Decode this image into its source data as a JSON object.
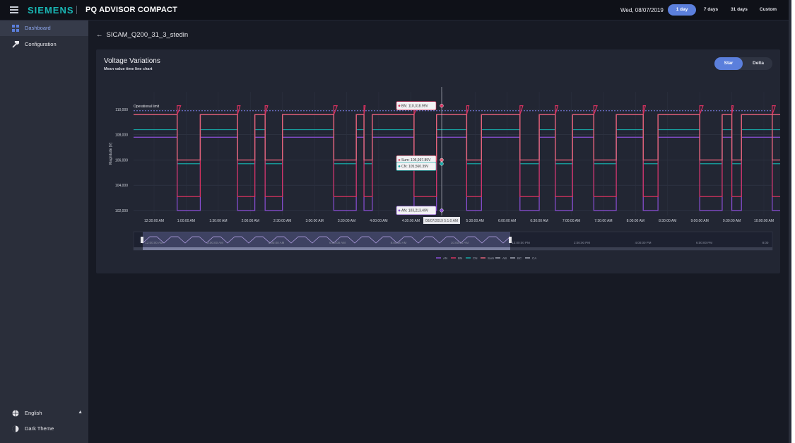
{
  "header": {
    "brand": "SIEMENS",
    "app_title": "PQ ADVISOR COMPACT",
    "date": "Wed, 08/07/2019",
    "ranges": [
      "1 day",
      "7 days",
      "31 days",
      "Custom"
    ],
    "active_range": "1 day"
  },
  "sidebar": {
    "items": [
      {
        "label": "Dashboard",
        "icon": "dashboard-icon",
        "active": true
      },
      {
        "label": "Configuration",
        "icon": "wrench-icon",
        "active": false
      }
    ],
    "footer": [
      {
        "label": "English",
        "icon": "globe-icon"
      },
      {
        "label": "Dark Theme",
        "icon": "contrast-icon"
      }
    ]
  },
  "main": {
    "back_label": "SICAM_Q200_31_3_stedin",
    "card": {
      "title": "Voltage Variations",
      "subtitle": "Mean value time line chart",
      "toggle": [
        "Star",
        "Delta"
      ],
      "toggle_active": "Star"
    }
  },
  "colors": {
    "AN": "#8b4fd6",
    "BN": "#d8325f",
    "CN": "#16a8a6",
    "Sum": "#e2627a",
    "limit": "#7c7ee8",
    "accent": "#5b7fdc"
  },
  "chart_data": {
    "type": "line",
    "title": "Voltage Variations",
    "subtitle": "Mean value time line chart",
    "ylabel": "Magnitude [V]",
    "y_ticks": [
      "110,000",
      "108,000",
      "106,000",
      "104,000",
      "102,000"
    ],
    "x_ticks": [
      "12:30:00 AM",
      "1:00:00 AM",
      "1:30:00 AM",
      "2:00:00 AM",
      "2:30:00 AM",
      "3:00:00 AM",
      "3:30:00 AM",
      "4:00:00 AM",
      "4:30:00 AM",
      "5:00:00 AM",
      "5:30:00 AM",
      "6:00:00 AM",
      "6:30:00 AM",
      "7:00:00 AM",
      "7:30:00 AM",
      "8:00:00 AM",
      "8:30:00 AM",
      "9:00:00 AM",
      "9:30:00 AM",
      "10:00:00 AM"
    ],
    "navigator_ticks": [
      "12:00:00 AM",
      "2:00:00 AM",
      "4:00:00 AM",
      "6:00:00 AM",
      "8:00:00 AM",
      "10:00:00 AM",
      "12:00:00 PM",
      "2:00:00 PM",
      "4:00:00 PM",
      "6:00:00 PM",
      "8:00"
    ],
    "operational_limit": {
      "label": "Operational limit",
      "value": 109.9
    },
    "levels": {
      "BN": {
        "high": 109.6,
        "low": 103.1
      },
      "Sum": {
        "high": 109.6,
        "low": 106.0
      },
      "CN": {
        "high": 108.4,
        "low": 105.7
      },
      "AN": {
        "high": 107.8,
        "low": 102.0
      }
    },
    "intervals": [
      {
        "start": 0.36,
        "end": 0.72
      },
      {
        "start": 1.3,
        "end": 1.57
      },
      {
        "start": 1.73,
        "end": 2.0
      },
      {
        "start": 2.8,
        "end": 3.15
      },
      {
        "start": 3.27,
        "end": 3.4
      },
      {
        "start": 4.05,
        "end": 4.4
      },
      {
        "start": 4.87,
        "end": 5.1
      },
      {
        "start": 5.7,
        "end": 6.0
      },
      {
        "start": 6.25,
        "end": 6.52
      },
      {
        "start": 6.85,
        "end": 7.2
      },
      {
        "start": 7.62,
        "end": 7.85
      },
      {
        "start": 8.5,
        "end": 8.85
      },
      {
        "start": 9.0,
        "end": 9.15
      },
      {
        "start": 9.63,
        "end": 9.95
      }
    ],
    "tooltips": [
      {
        "series": "BN",
        "text": "BN: 110,318.99V"
      },
      {
        "series": "Sum",
        "text": "Sum: 105,997.89V"
      },
      {
        "series": "CN",
        "text": "CN: 105,560.39V"
      },
      {
        "series": "AN",
        "text": "AN: 103,213.49V"
      }
    ],
    "crosshair_label": "08/07/2019 5:1:0 AM",
    "legend": [
      "AN",
      "BN",
      "CN",
      "Sum",
      "AB",
      "BC",
      "CA"
    ],
    "grid": true,
    "legend_position": "bottom-center"
  }
}
